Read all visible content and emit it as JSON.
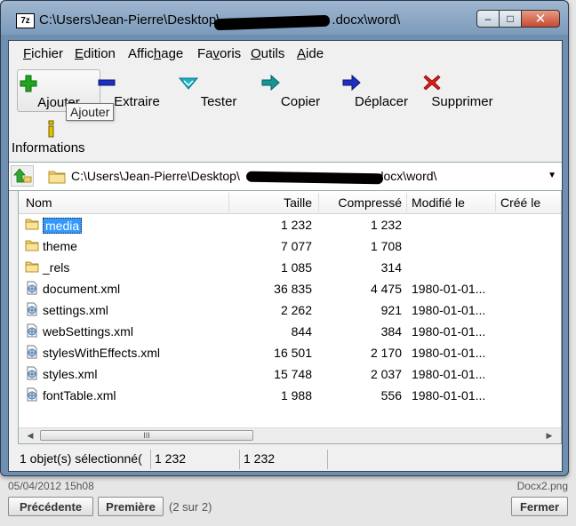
{
  "window": {
    "title": "C:\\Users\\Jean-Pierre\\Desktop\\",
    "title_tail": ".docx\\word\\",
    "app_icon": "7z",
    "controls": {
      "minimize": "–",
      "maximize": "□",
      "close": "✕"
    }
  },
  "menu": [
    {
      "hot": "F",
      "rest": "ichier"
    },
    {
      "hot": "E",
      "rest": "dition"
    },
    {
      "pre": "Affic",
      "hot": "h",
      "rest": "age"
    },
    {
      "pre": "Fa",
      "hot": "v",
      "rest": "oris"
    },
    {
      "hot": "O",
      "rest": "utils"
    },
    {
      "hot": "A",
      "rest": "ide"
    }
  ],
  "toolbar": {
    "add": "Ajouter",
    "extract": "Extraire",
    "test": "Tester",
    "copy": "Copier",
    "move": "Déplacer",
    "delete": "Supprimer",
    "info": "Informations",
    "tooltip": "Ajouter",
    "colors": {
      "add": "#1fa51f",
      "extract": "#1c2fbf",
      "test": "#19b2c9",
      "copy": "#149696",
      "move": "#1c2fbf",
      "delete": "#d81b1b",
      "info": "#e5c200"
    }
  },
  "address": {
    "path_start": "C:\\Users\\Jean-Pierre\\Desktop\\",
    "path_end": ".docx\\word\\"
  },
  "columns": {
    "name": "Nom",
    "size": "Taille",
    "packed": "Compressé",
    "modified": "Modifié le",
    "created": "Créé le"
  },
  "files": [
    {
      "name": "media",
      "type": "folder",
      "size": "1 232",
      "packed": "1 232",
      "modified": "",
      "selected": true
    },
    {
      "name": "theme",
      "type": "folder",
      "size": "7 077",
      "packed": "1 708",
      "modified": ""
    },
    {
      "name": "_rels",
      "type": "folder",
      "size": "1 085",
      "packed": "314",
      "modified": ""
    },
    {
      "name": "document.xml",
      "type": "file",
      "size": "36 835",
      "packed": "4 475",
      "modified": "1980-01-01..."
    },
    {
      "name": "settings.xml",
      "type": "file",
      "size": "2 262",
      "packed": "921",
      "modified": "1980-01-01..."
    },
    {
      "name": "webSettings.xml",
      "type": "file",
      "size": "844",
      "packed": "384",
      "modified": "1980-01-01..."
    },
    {
      "name": "stylesWithEffects.xml",
      "type": "file",
      "size": "16 501",
      "packed": "2 170",
      "modified": "1980-01-01..."
    },
    {
      "name": "styles.xml",
      "type": "file",
      "size": "15 748",
      "packed": "2 037",
      "modified": "1980-01-01..."
    },
    {
      "name": "fontTable.xml",
      "type": "file",
      "size": "1 988",
      "packed": "556",
      "modified": "1980-01-01..."
    }
  ],
  "scrollbar": {
    "left": "◀",
    "right": "▶",
    "grip": "III"
  },
  "status": {
    "selection": "1 objet(s) sélectionné(",
    "size": "1 232",
    "packed": "1 232"
  },
  "viewer": {
    "date": "05/04/2012 15h08",
    "filename": "Docx2.png",
    "prev": "Précédente",
    "first": "Première",
    "count": "(2 sur 2)",
    "close": "Fermer"
  }
}
